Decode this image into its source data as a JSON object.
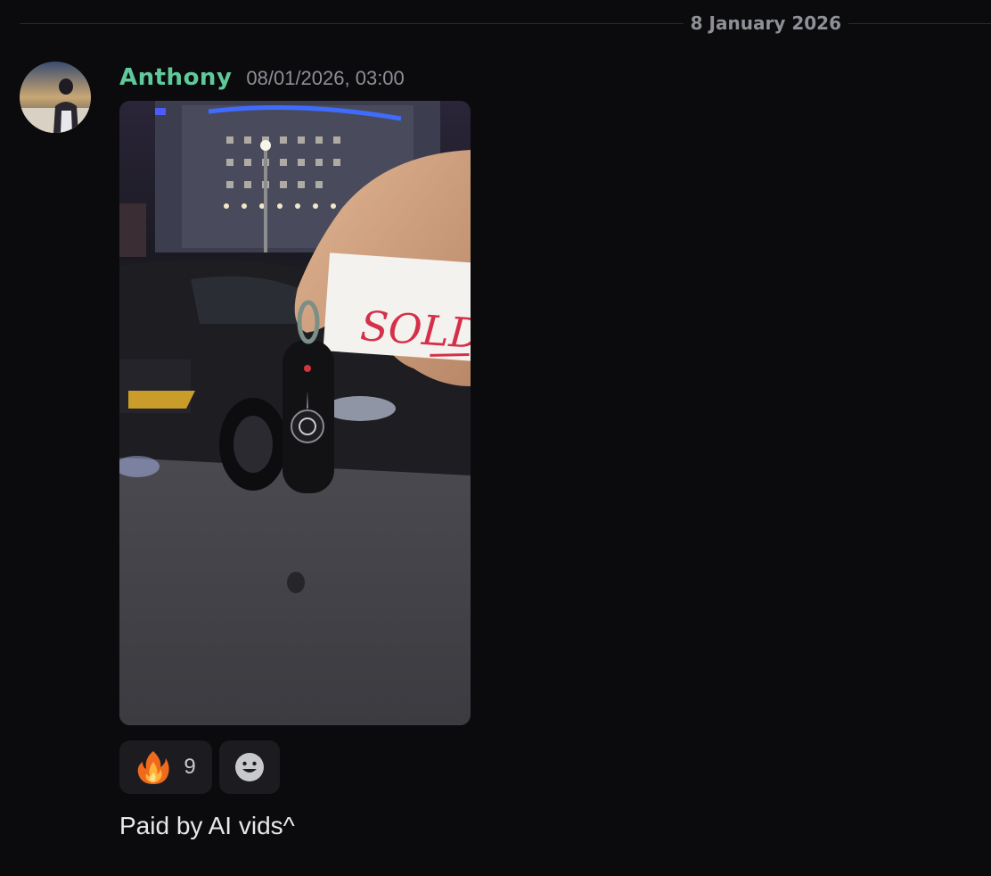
{
  "date_divider": {
    "label": "8 January 2026"
  },
  "message": {
    "author": "Anthony",
    "timestamp": "08/01/2026, 03:00",
    "text": "Paid by AI vids^",
    "attachment": {
      "type": "image",
      "note_text": "SOLD"
    },
    "reactions": [
      {
        "emoji": "fire-icon",
        "count": "9"
      }
    ],
    "add_reaction_icon": "smiley-icon"
  },
  "colors": {
    "background": "#0b0a0d",
    "username": "#5fc99a",
    "timestamp": "#8e9097",
    "reaction_bg": "#1c1c20"
  }
}
